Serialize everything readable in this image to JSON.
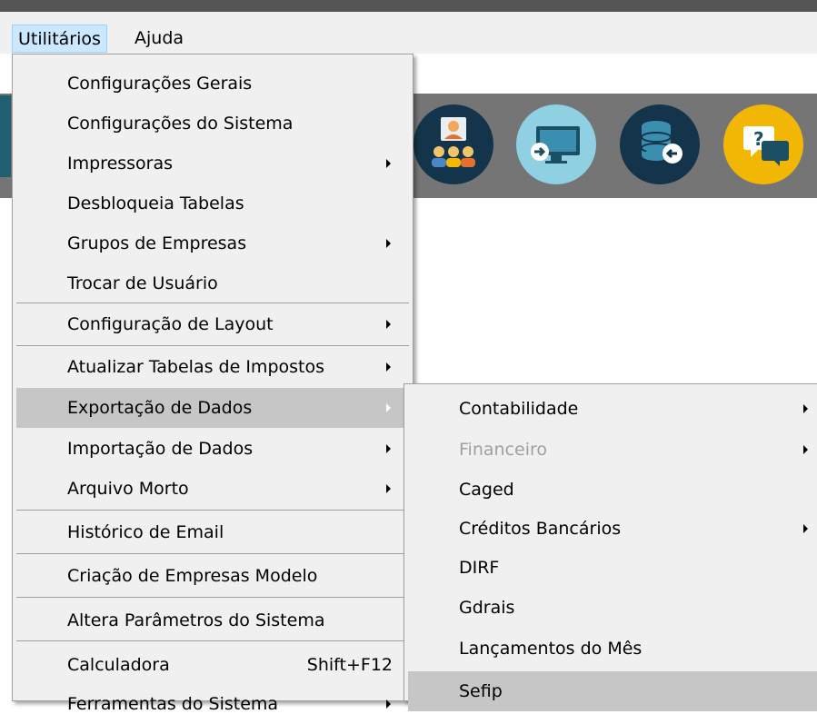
{
  "menubar": {
    "items": [
      {
        "label": "Utilitários",
        "active": true
      },
      {
        "label": "Ajuda",
        "active": false
      }
    ]
  },
  "toolbar": {
    "icons": [
      {
        "name": "users-meeting-icon",
        "color": "#13344a"
      },
      {
        "name": "monitor-transfer-icon",
        "color": "#8fd0e2"
      },
      {
        "name": "database-import-icon",
        "color": "#13344a"
      },
      {
        "name": "help-chat-icon",
        "color": "#f2b705"
      }
    ]
  },
  "main_menu": {
    "items": [
      {
        "label": "Configurações Gerais",
        "has_submenu": false
      },
      {
        "label": "Configurações do Sistema",
        "has_submenu": false
      },
      {
        "label": "Impressoras",
        "has_submenu": true
      },
      {
        "label": "Desbloqueia Tabelas",
        "has_submenu": false
      },
      {
        "label": "Grupos de Empresas",
        "has_submenu": true
      },
      {
        "label": "Trocar de Usuário",
        "has_submenu": false
      },
      {
        "label": "Configuração de Layout",
        "has_submenu": true
      },
      {
        "label": "Atualizar Tabelas de Impostos",
        "has_submenu": true
      },
      {
        "label": "Exportação de Dados",
        "has_submenu": true,
        "selected": true
      },
      {
        "label": "Importação de Dados",
        "has_submenu": true
      },
      {
        "label": "Arquivo Morto",
        "has_submenu": true
      },
      {
        "label": "Histórico de Email",
        "has_submenu": false
      },
      {
        "label": "Criação de Empresas Modelo",
        "has_submenu": false
      },
      {
        "label": "Altera Parâmetros do Sistema",
        "has_submenu": false
      },
      {
        "label": "Calculadora",
        "has_submenu": false,
        "shortcut": "Shift+F12"
      },
      {
        "label": "Ferramentas do Sistema",
        "has_submenu": true
      }
    ]
  },
  "sub_menu": {
    "items": [
      {
        "label": "Contabilidade",
        "has_submenu": true
      },
      {
        "label": "Financeiro",
        "has_submenu": true,
        "disabled": true
      },
      {
        "label": "Caged",
        "has_submenu": false
      },
      {
        "label": "Créditos Bancários",
        "has_submenu": true
      },
      {
        "label": "DIRF",
        "has_submenu": false
      },
      {
        "label": "Gdrais",
        "has_submenu": false
      },
      {
        "label": "Lançamentos do Mês",
        "has_submenu": false
      },
      {
        "label": "Sefip",
        "has_submenu": false,
        "selected": true
      }
    ]
  },
  "colors": {
    "menu_bg": "#f0f0f0",
    "selected_bg": "#c6c6c6",
    "toolbar_bg": "#757575",
    "disabled_text": "#a0a0a0"
  }
}
